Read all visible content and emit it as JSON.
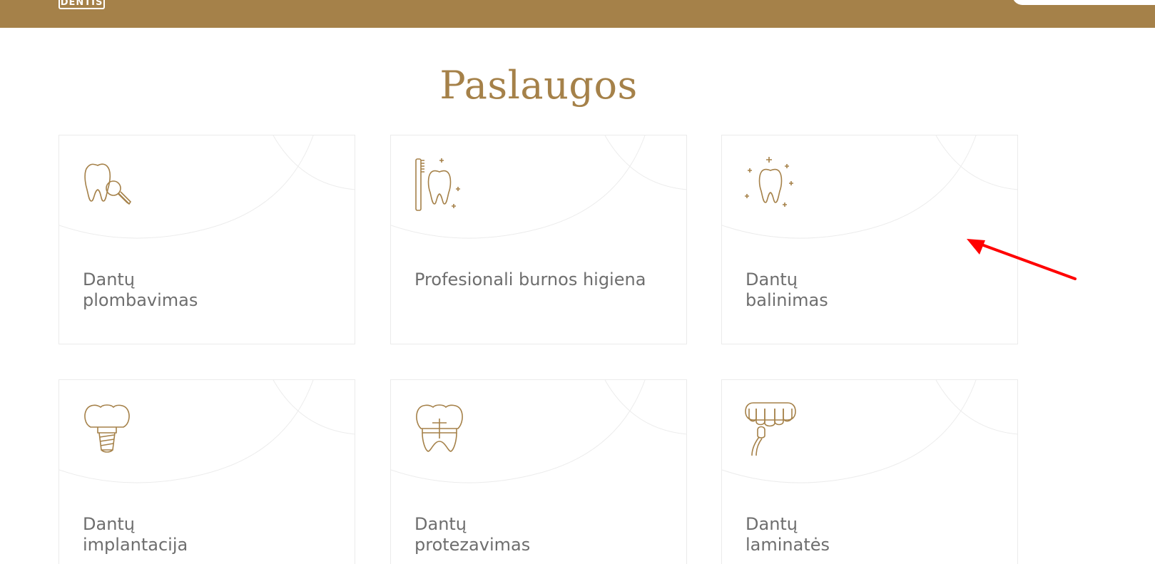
{
  "header": {
    "logo_text": "DENTIS"
  },
  "section": {
    "title": "Paslaugos"
  },
  "services": [
    {
      "label": "Dantų\nplombavimas",
      "icon": "tooth-magnifier-icon"
    },
    {
      "label": "Profesionali burnos higiena",
      "icon": "toothbrush-tooth-icon"
    },
    {
      "label": "Dantų\nbalinimas",
      "icon": "sparkling-tooth-icon"
    },
    {
      "label": "Dantų\nimplantacija",
      "icon": "dental-implant-icon"
    },
    {
      "label": "Dantų\nprotezavimas",
      "icon": "dental-crown-icon"
    },
    {
      "label": "Dantų\nlaminatės",
      "icon": "veneers-icon"
    }
  ],
  "colors": {
    "brand_gold": "#a58149",
    "text_gray": "#6e6e6e",
    "card_border": "#ebebeb",
    "annotation_red": "#ff0000"
  }
}
